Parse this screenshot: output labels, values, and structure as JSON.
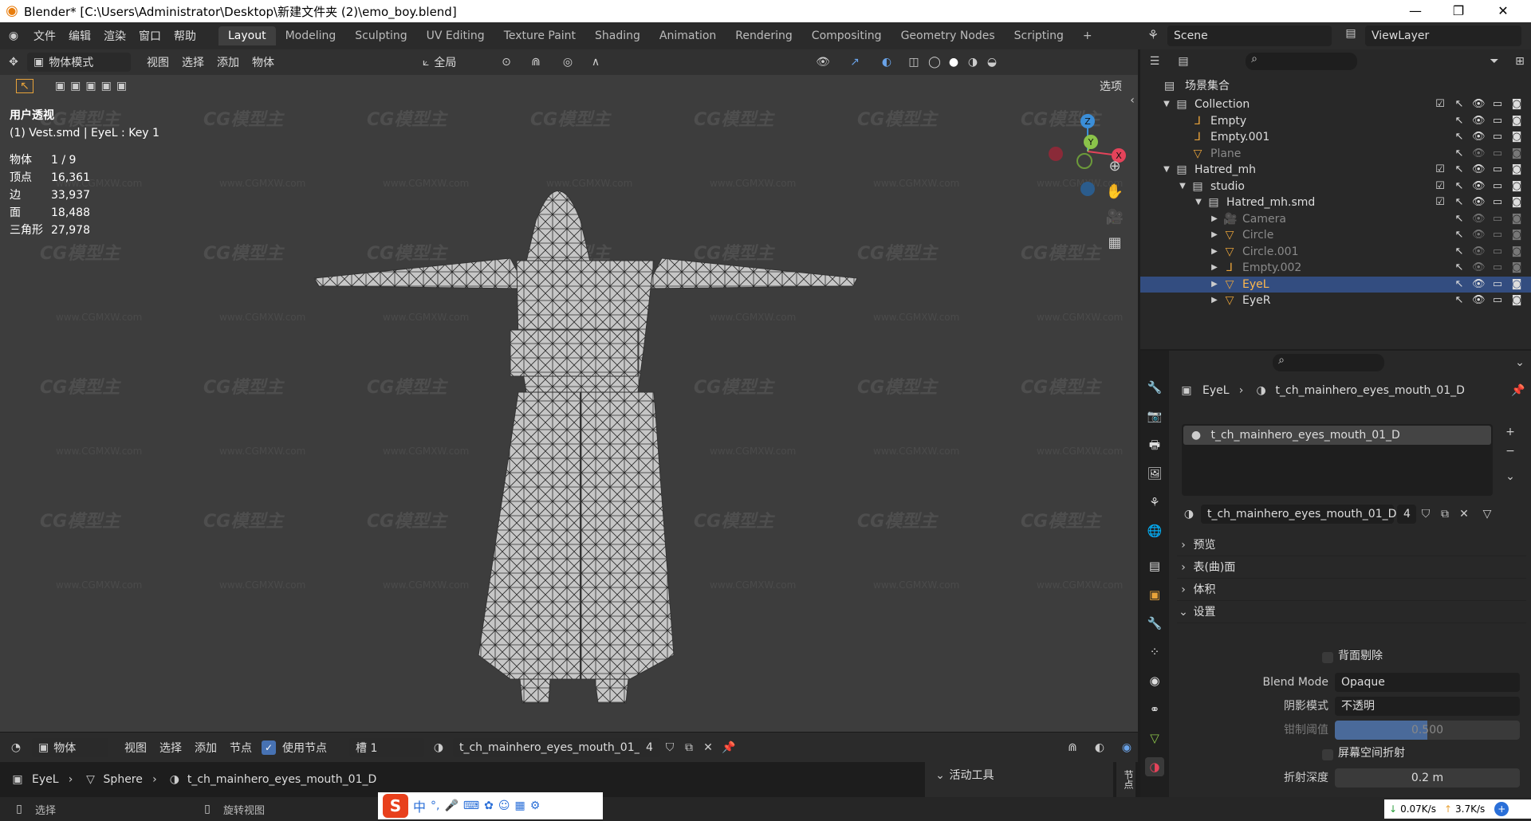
{
  "window": {
    "title": "Blender* [C:\\Users\\Administrator\\Desktop\\新建文件夹 (2)\\emo_boy.blend]",
    "minimize": "—",
    "maximize": "❐",
    "close": "✕"
  },
  "menu": [
    "文件",
    "编辑",
    "渲染",
    "窗口",
    "帮助"
  ],
  "workspaces": [
    "Layout",
    "Modeling",
    "Sculpting",
    "UV Editing",
    "Texture Paint",
    "Shading",
    "Animation",
    "Rendering",
    "Compositing",
    "Geometry Nodes",
    "Scripting",
    "+"
  ],
  "active_workspace": "Layout",
  "scene": {
    "name": "Scene",
    "view_layer": "ViewLayer"
  },
  "viewport": {
    "mode": "物体模式",
    "menus": [
      "视图",
      "选择",
      "添加",
      "物体"
    ],
    "transform": "全局",
    "options": "选项",
    "view_name": "用户透视",
    "active_info": "(1) Vest.smd | EyeL : Key 1",
    "stats": [
      {
        "label": "物体",
        "value": "1 / 9"
      },
      {
        "label": "顶点",
        "value": "16,361"
      },
      {
        "label": "边",
        "value": "33,937"
      },
      {
        "label": "面",
        "value": "18,488"
      },
      {
        "label": "三角形",
        "value": "27,978"
      }
    ],
    "gizmo_axes": {
      "z": "Z",
      "y": "Y",
      "x": "X"
    },
    "colors": {
      "x": "#e4435a",
      "y": "#8bc34a",
      "z": "#3b8ed8",
      "bg": "#3d3d3d",
      "mesh": "#c9c9c9"
    }
  },
  "watermark": {
    "logo": "CG模型主",
    "url": "www.CGMXW.com"
  },
  "outliner": {
    "root": "场景集合",
    "rows": [
      {
        "name": "Collection",
        "indent": 1,
        "icon": "collection",
        "check": true,
        "dim": false,
        "selected": false
      },
      {
        "name": "Empty",
        "indent": 2,
        "icon": "empty",
        "check": false,
        "dim": false,
        "selected": false
      },
      {
        "name": "Empty.001",
        "indent": 2,
        "icon": "empty",
        "check": false,
        "dim": false,
        "selected": false
      },
      {
        "name": "Plane",
        "indent": 2,
        "icon": "mesh",
        "check": false,
        "dim": true,
        "selected": false
      },
      {
        "name": "Hatred_mh",
        "indent": 1,
        "icon": "collection",
        "check": true,
        "dim": false,
        "selected": false
      },
      {
        "name": "studio",
        "indent": 2,
        "icon": "collection",
        "check": true,
        "dim": false,
        "selected": false
      },
      {
        "name": "Hatred_mh.smd",
        "indent": 3,
        "icon": "collection",
        "check": true,
        "dim": false,
        "selected": false
      },
      {
        "name": "Camera",
        "indent": 4,
        "icon": "camera",
        "check": false,
        "dim": true,
        "selected": false
      },
      {
        "name": "Circle",
        "indent": 4,
        "icon": "mesh",
        "check": false,
        "dim": true,
        "selected": false
      },
      {
        "name": "Circle.001",
        "indent": 4,
        "icon": "mesh",
        "check": false,
        "dim": true,
        "selected": false
      },
      {
        "name": "Empty.002",
        "indent": 4,
        "icon": "empty",
        "check": false,
        "dim": true,
        "selected": false
      },
      {
        "name": "EyeL",
        "indent": 4,
        "icon": "mesh",
        "check": false,
        "dim": false,
        "selected": true
      },
      {
        "name": "EyeR",
        "indent": 4,
        "icon": "mesh",
        "check": false,
        "dim": false,
        "selected": false
      }
    ]
  },
  "properties": {
    "breadcrumb_object": "EyeL",
    "breadcrumb_material": "t_ch_mainhero_eyes_mouth_01_D",
    "slot_name": "t_ch_mainhero_eyes_mouth_01_D",
    "material_name": "t_ch_mainhero_eyes_mouth_01_D",
    "users": "4",
    "panels": [
      "预览",
      "表(曲)面",
      "体积",
      "设置"
    ],
    "backface": "背面剔除",
    "blend_mode_label": "Blend Mode",
    "blend_mode": "Opaque",
    "shadow_label": "阴影模式",
    "shadow": "不透明",
    "clip_label": "钳制阈值",
    "clip": "0.500",
    "ssr": "屏幕空间折射",
    "refr_label": "折射深度",
    "refr": "0.2 m"
  },
  "node_header": {
    "type": "物体",
    "menus": [
      "视图",
      "选择",
      "添加",
      "节点"
    ],
    "use_nodes": "使用节点",
    "slot": "槽 1",
    "material": "t_ch_mainhero_eyes_mouth_01_D",
    "users": "4",
    "active_tool": "活动工具",
    "side_tab": "节点"
  },
  "node_breadcrumb": {
    "object": "EyeL",
    "mesh": "Sphere",
    "material": "t_ch_mainhero_eyes_mouth_01_D"
  },
  "status": {
    "select": "选择",
    "rotate": "旋转视图",
    "down": "0.07K/s",
    "up": "3.7K/s"
  },
  "ime": {
    "label": "中"
  }
}
